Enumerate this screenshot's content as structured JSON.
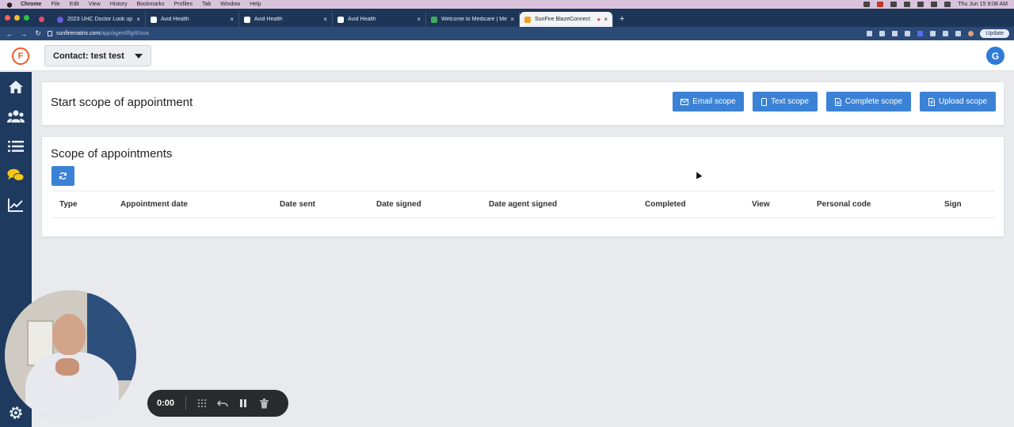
{
  "mac_menu": {
    "items": [
      "Chrome",
      "File",
      "Edit",
      "View",
      "History",
      "Bookmarks",
      "Profiles",
      "Tab",
      "Window",
      "Help"
    ],
    "clock": "Thu Jun 15  9:08 AM"
  },
  "browser": {
    "tabs": [
      {
        "title": "2023 UHC Doctor Look up",
        "favicon_color": "#6b5bd6"
      },
      {
        "title": "Avid Health",
        "favicon_color": "#ffffff"
      },
      {
        "title": "Avid Health",
        "favicon_color": "#ffffff"
      },
      {
        "title": "Avid Health",
        "favicon_color": "#ffffff"
      },
      {
        "title": "Welcome to Medicare | Medicare",
        "favicon_color": "#3fae5b"
      },
      {
        "title": "SunFire BlazeConnect",
        "favicon_color": "#f0a020"
      }
    ],
    "active_tab_index": 5,
    "address": {
      "host": "sunfirematrix.com",
      "path": "/app/agent/lfg/#/soa"
    },
    "update_label": "Update"
  },
  "header": {
    "logo_text": "F",
    "contact_label": "Contact: test test",
    "user_initial": "G"
  },
  "sidebar": {
    "items": [
      "home-icon",
      "people-icon",
      "list-icon",
      "chat-icon",
      "chart-icon"
    ],
    "active_color": "#f5c518"
  },
  "start_scope": {
    "title": "Start scope of appointment",
    "buttons": {
      "email": "Email scope",
      "text": "Text scope",
      "complete": "Complete scope",
      "upload": "Upload scope"
    }
  },
  "scope_list": {
    "title": "Scope of appointments",
    "columns": [
      "Type",
      "Appointment date",
      "Date sent",
      "Date signed",
      "Date agent signed",
      "Completed",
      "View",
      "Personal code",
      "Sign"
    ]
  },
  "recorder": {
    "time": "0:00"
  },
  "colors": {
    "brand_blue": "#3b82d6",
    "sidebar": "#1f3a5f",
    "logo_orange": "#f05a28"
  }
}
